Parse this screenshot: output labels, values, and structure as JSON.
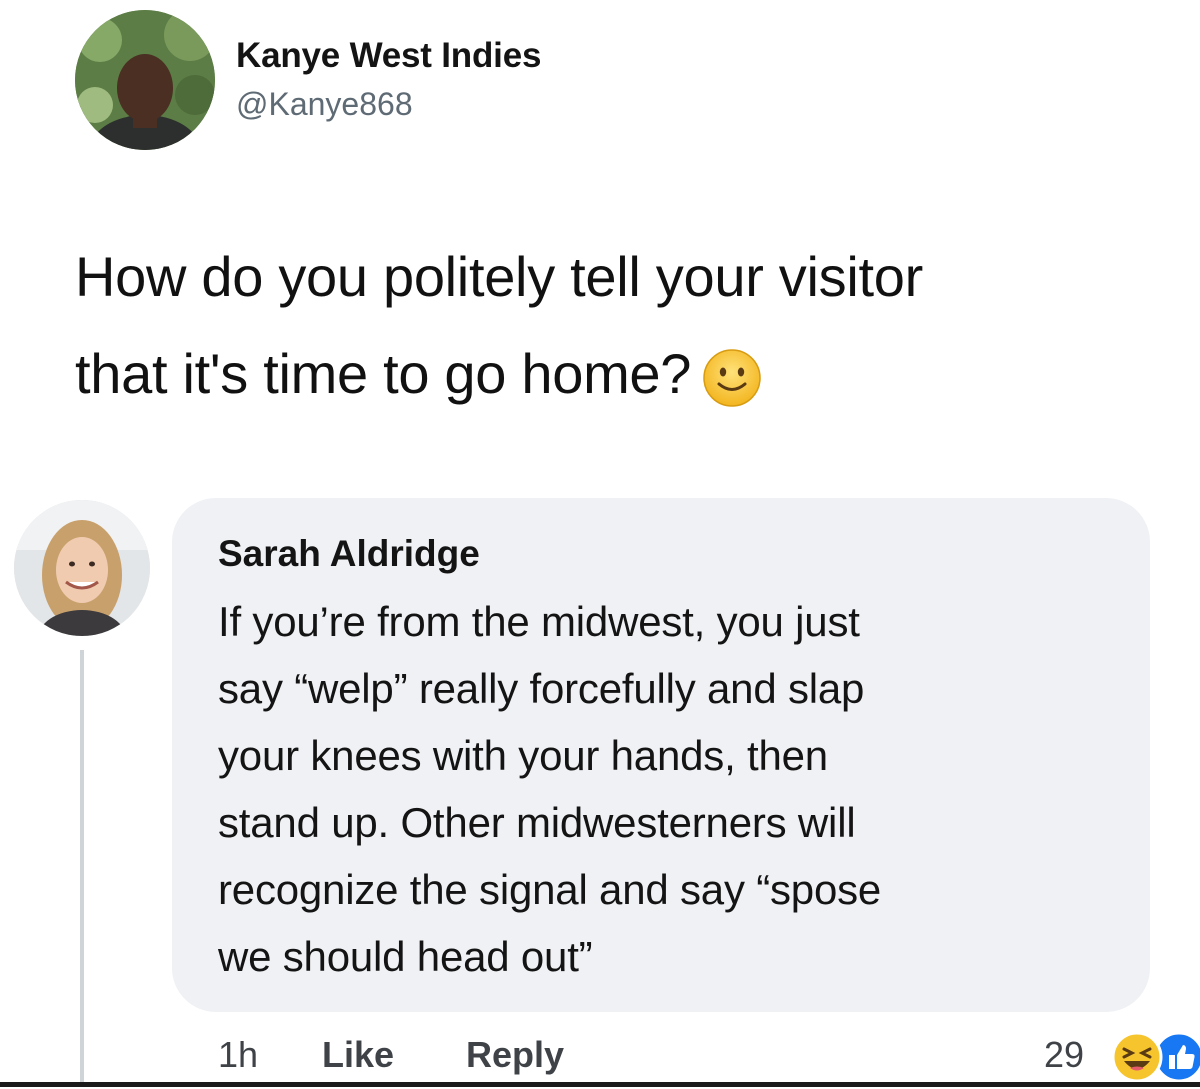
{
  "tweet": {
    "author_name": "Kanye West Indies",
    "author_handle": "@Kanye868",
    "text_line1": "How do you politely tell your visitor",
    "text_line2": "that it's time to go home?",
    "emoji": "slightly-smiling-face-icon"
  },
  "comment": {
    "author": "Sarah Aldridge",
    "lines": [
      "If you’re from the midwest, you just",
      "say “welp” really forcefully and slap",
      "your knees with your hands, then",
      "stand up. Other midwesterners will",
      "recognize the signal and say “spose",
      "we should head out”"
    ],
    "time": "1h",
    "like_label": "Like",
    "reply_label": "Reply",
    "reaction_count": "29",
    "reactions": [
      "haha-reaction-icon",
      "like-reaction-icon"
    ]
  },
  "colors": {
    "bubble": "#eff1f4",
    "handle": "#5e6a74",
    "action_text": "#3f4348",
    "like_blue": "#1877f2",
    "emoji_yellow": "#f6c52e"
  }
}
